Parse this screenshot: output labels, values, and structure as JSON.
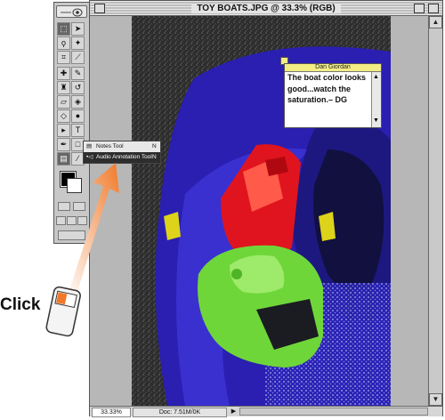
{
  "window": {
    "title": "TOY BOATS.JPG @ 33.3% (RGB)"
  },
  "note": {
    "author": "Dan Giordan",
    "text": "The boat color looks good...watch the saturation.– DG"
  },
  "flyout": {
    "items": [
      {
        "label": "Notes Tool",
        "shortcut": "N",
        "checked": false
      },
      {
        "label": "Audio Annotation Tool",
        "shortcut": "N",
        "checked": true
      }
    ]
  },
  "status": {
    "zoom": "33.33%",
    "doc_size": "Doc: 7.51M/0K",
    "arrow": "▶"
  },
  "annotation": {
    "click_label": "Click"
  },
  "colors": {
    "foreground": "#000000",
    "background": "#ffffff",
    "note_header": "#f3ed84",
    "arrow": "#f07a2a"
  }
}
